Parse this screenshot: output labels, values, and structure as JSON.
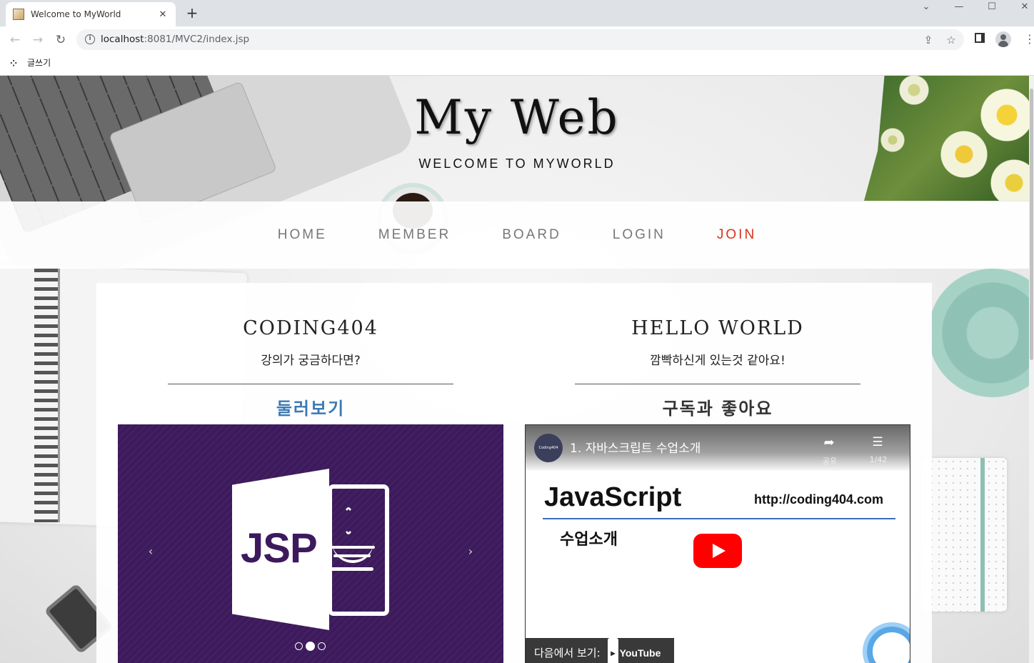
{
  "browser": {
    "tab_title": "Welcome to MyWorld",
    "url_host": "localhost",
    "url_rest": ":8081/MVC2/index.jsp",
    "bookmark_label": "글쓰기",
    "window_controls": [
      "⌄",
      "—",
      "☐",
      "✕"
    ]
  },
  "header": {
    "title": "My Web",
    "subtitle": "WELCOME TO MYWORLD"
  },
  "nav": {
    "items": [
      "HOME",
      "MEMBER",
      "BOARD",
      "LOGIN",
      "JOIN"
    ],
    "active_color": "#d9321f"
  },
  "left": {
    "title": "CODING404",
    "subtitle": "강의가 궁금하다면?",
    "link": "둘러보기",
    "link_color": "#3a7ab5",
    "carousel": {
      "slide_text": "JSP",
      "prev": "‹",
      "next": "›",
      "slide_count": 3,
      "active_slide": 2
    }
  },
  "right": {
    "title": "HELLO WORLD",
    "subtitle": "깜빡하신게 있는것 같아요!",
    "heading": "구독과 좋아요",
    "video": {
      "channel": "Coding404",
      "title": "1. 자바스크립트 수업소개",
      "share_label": "공유",
      "playlist_label": "1/42",
      "slide_heading": "JavaScript",
      "slide_url": "http://coding404.com",
      "slide_sub": "수업소개",
      "watch_on": "다음에서 보기:",
      "youtube": "YouTube"
    }
  }
}
